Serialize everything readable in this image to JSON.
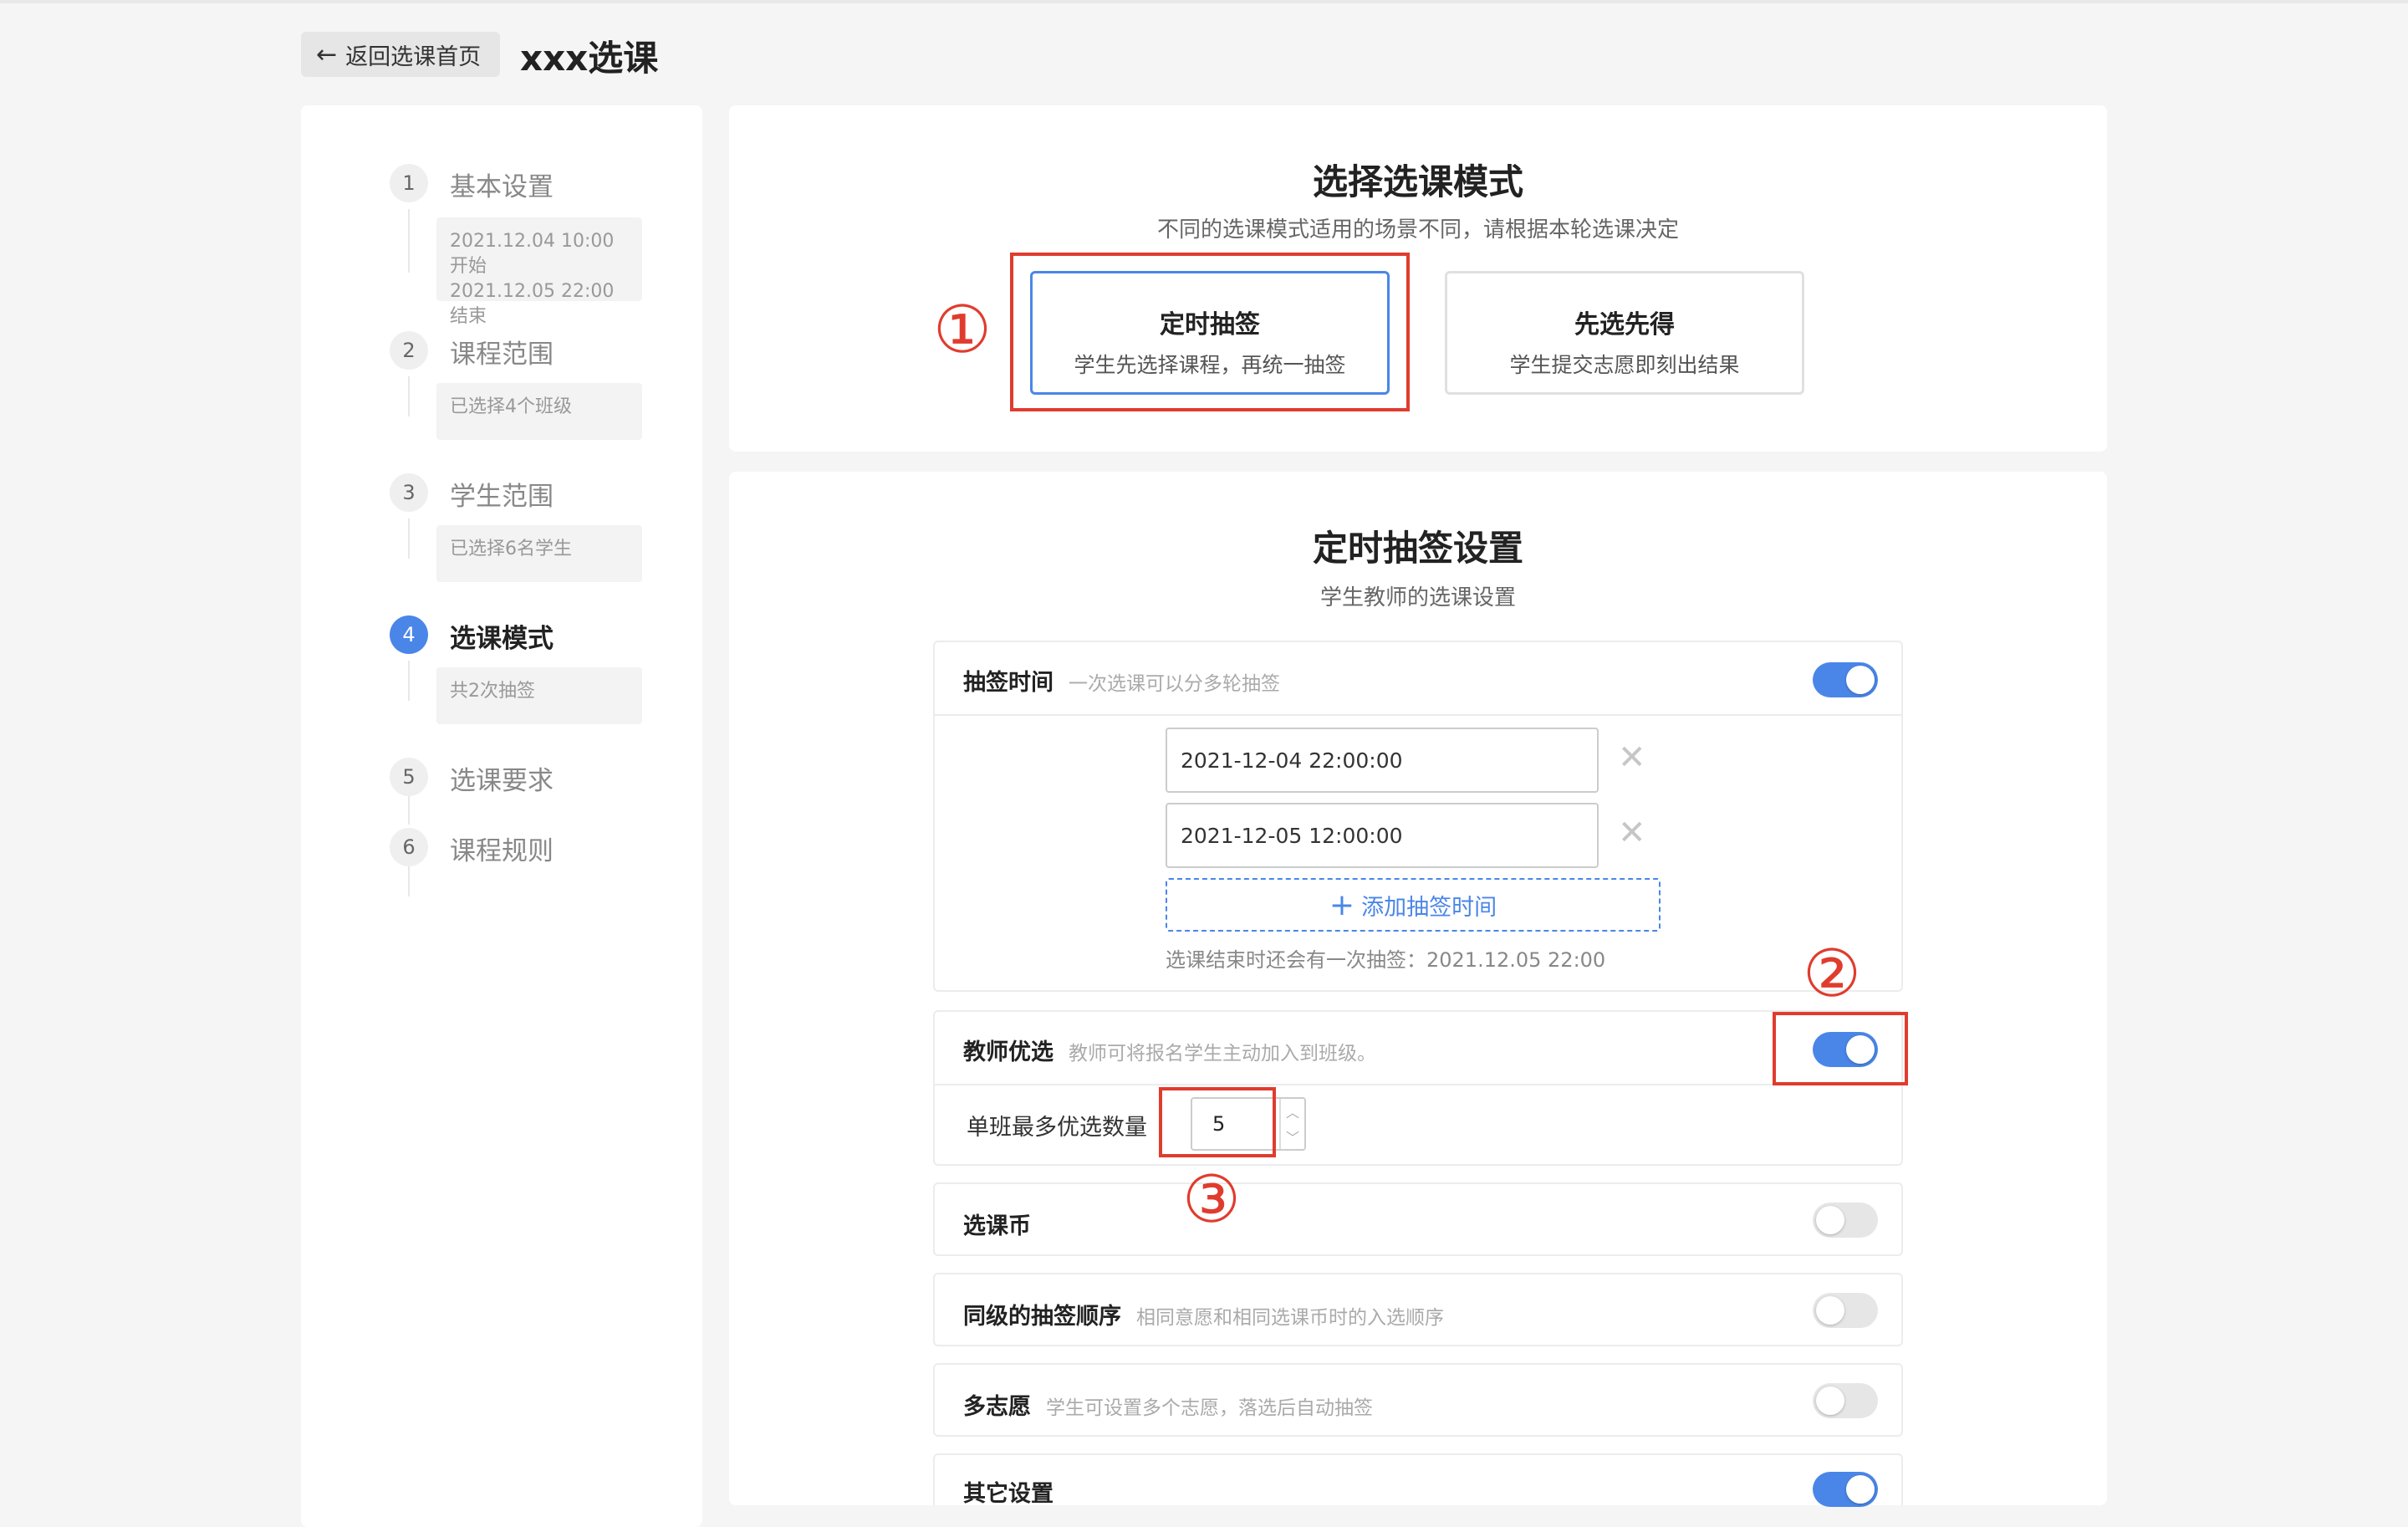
{
  "header": {
    "back_label": "返回选课首页",
    "title": "xxx选课"
  },
  "sidebar": {
    "steps": [
      {
        "num": "1",
        "label": "基本设置",
        "summary_lines": [
          "2021.12.04 10:00 开始",
          "2021.12.05 22:00 结束"
        ]
      },
      {
        "num": "2",
        "label": "课程范围",
        "summary_lines": [
          "已选择4个班级"
        ]
      },
      {
        "num": "3",
        "label": "学生范围",
        "summary_lines": [
          "已选择6名学生"
        ]
      },
      {
        "num": "4",
        "label": "选课模式",
        "summary_lines": [
          "共2次抽签"
        ],
        "active": true
      },
      {
        "num": "5",
        "label": "选课要求"
      },
      {
        "num": "6",
        "label": "课程规则"
      }
    ]
  },
  "mode_panel": {
    "title": "选择选课模式",
    "subtitle": "不同的选课模式适用的场景不同，请根据本轮选课决定",
    "options": [
      {
        "title": "定时抽签",
        "desc": "学生先选择课程，再统一抽签",
        "selected": true
      },
      {
        "title": "先选先得",
        "desc": "学生提交志愿即刻出结果",
        "selected": false
      }
    ]
  },
  "settings_panel": {
    "title": "定时抽签设置",
    "subtitle": "学生教师的选课设置",
    "draw_time": {
      "label": "抽签时间",
      "desc": "一次选课可以分多轮抽签",
      "enabled": true,
      "times": [
        "2021-12-04 22:00:00",
        "2021-12-05 12:00:00"
      ],
      "add_label": "添加抽签时间",
      "hint": "选课结束时还会有一次抽签：2021.12.05 22:00"
    },
    "teacher_pick": {
      "label": "教师优选",
      "desc": "教师可将报名学生主动加入到班级。",
      "enabled": true,
      "max_label": "单班最多优选数量",
      "max_value": "5"
    },
    "coins": {
      "label": "选课币",
      "enabled": false
    },
    "same_level_order": {
      "label": "同级的抽签顺序",
      "desc": "相同意愿和相同选课币时的入选顺序",
      "enabled": false
    },
    "multi_wish": {
      "label": "多志愿",
      "desc": "学生可设置多个志愿，落选后自动抽签",
      "enabled": false
    },
    "other": {
      "label": "其它设置",
      "enabled": true
    }
  },
  "annotations": {
    "one": "①",
    "two": "②",
    "three": "③",
    "color": "#e03c2e"
  },
  "colors": {
    "accent": "#4a86e8",
    "toggle_off": "#e6e6e6",
    "background": "#f5f5f5"
  }
}
